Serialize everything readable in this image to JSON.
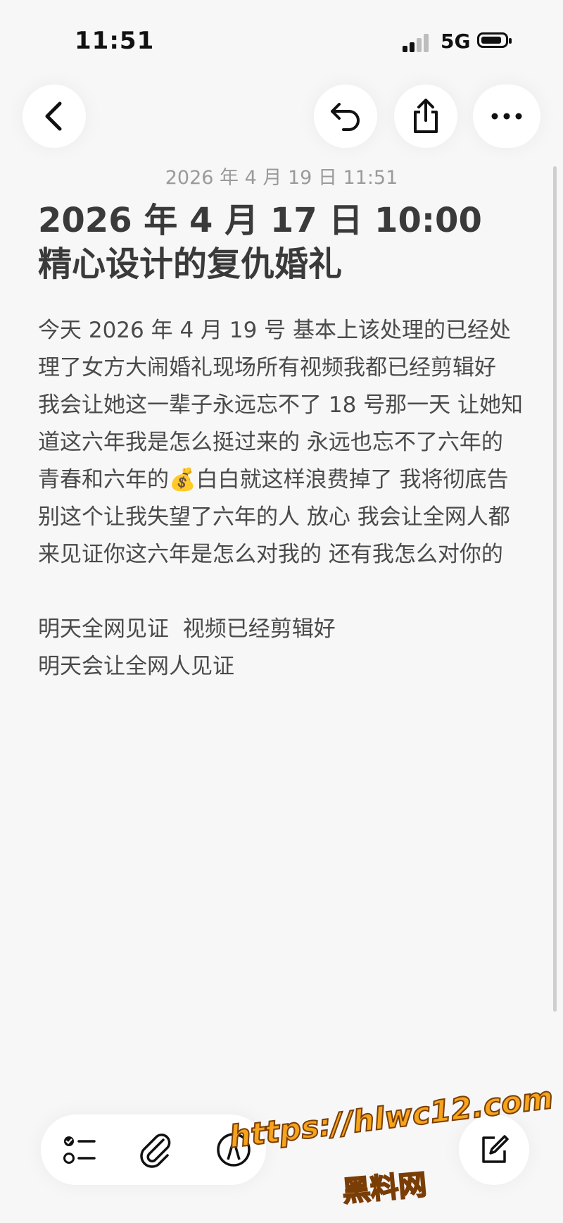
{
  "status_bar": {
    "time": "11:51",
    "network": "5G",
    "signal_icon": "cellular-signal-icon",
    "battery_icon": "battery-icon"
  },
  "toolbar": {
    "back_icon": "chevron-left-icon",
    "undo_icon": "undo-icon",
    "share_icon": "share-icon",
    "more_icon": "ellipsis-icon"
  },
  "note": {
    "date": "2026 年 4 月 19 日 11:51",
    "title": "2026 年 4 月 17 日 10:00 精心设计的复仇婚礼",
    "paragraphs": [
      "今天 2026 年 4 月 19 号 基本上该处理的已经处理了女方大闹婚礼现场所有视频我都已经剪辑好 我会让她这一辈子永远忘不了 18 号那一天 让她知道这六年我是怎么挺过来的 永远也忘不了六年的青春和六年的💰白白就这样浪费掉了 我将彻底告别这个让我失望了六年的人 放心 我会让全网人都来见证你这六年是怎么对我的 还有我怎么对你的",
      "明天全网见证  视频已经剪辑好",
      "明天会让全网人见证"
    ]
  },
  "bottom_toolbar": {
    "checklist_icon": "checklist-icon",
    "attach_icon": "paperclip-icon",
    "markup_icon": "markup-pen-icon",
    "compose_icon": "compose-icon"
  },
  "watermark": {
    "url": "https://hlwc12.com",
    "text": "黑料网"
  },
  "colors": {
    "background": "#f7f7f8",
    "watermark_fill": "#f5a41c"
  }
}
